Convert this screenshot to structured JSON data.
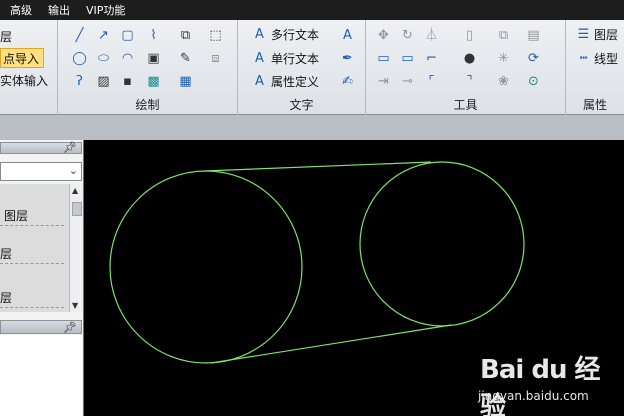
{
  "menu": {
    "items": [
      "高级",
      "输出",
      "VIP功能"
    ]
  },
  "ribbon": {
    "left_partial": {
      "item_1": "层",
      "item_2": "点导入",
      "item_3": "实体输入"
    },
    "draw_group": {
      "label": "绘制"
    },
    "text_group": {
      "label": "文字",
      "multiline_text": "多行文本",
      "single_text": "单行文本",
      "attr_define": "属性定义"
    },
    "tools_group": {
      "label": "工具"
    },
    "props_group": {
      "label": "属性",
      "layer": "图层",
      "linetype": "线型"
    }
  },
  "panel": {
    "layer_rows": [
      "图层",
      "层",
      "层"
    ]
  },
  "watermark": {
    "logo": "Bai du 经验",
    "url": "jingyan.baidu.com"
  },
  "colors": {
    "drawing_line": "#7fe36a",
    "canvas_bg": "#000000",
    "menubar_bg": "#1d1d1d",
    "highlight": "#ffdf7f"
  }
}
